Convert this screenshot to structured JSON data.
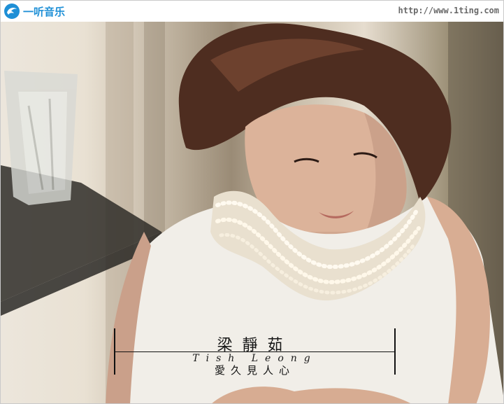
{
  "header": {
    "logo_text": "一听音乐",
    "site_url": "http://www.1ting.com"
  },
  "cover": {
    "artist_name_zh": "梁靜茹",
    "artist_name_en": "Tish Leong",
    "album_title_zh": "愛久見人心"
  },
  "icons": {
    "logo_mark": "dolphin-icon"
  },
  "colors": {
    "brand": "#1e8fd6",
    "url_text": "#6a6a6a"
  }
}
